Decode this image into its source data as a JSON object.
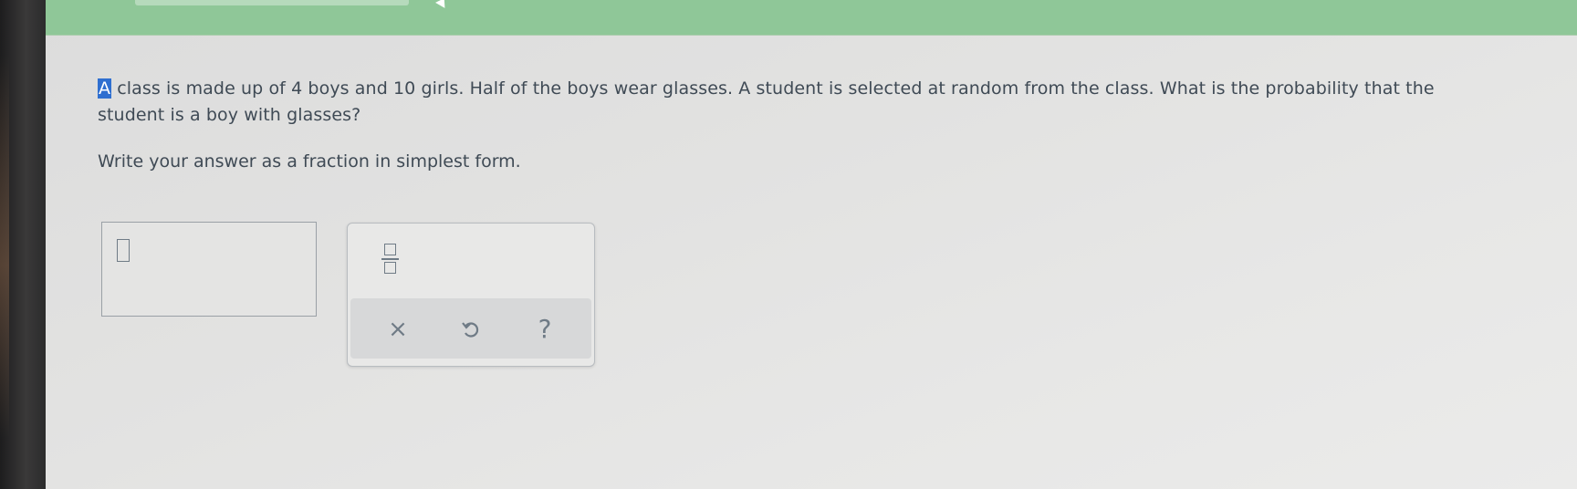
{
  "question": {
    "selected_letter": "A",
    "line1_rest": " class is made up of 4 boys and 10 girls. Half of the boys wear glasses. A student is selected at random from the class. What is the probability that the",
    "line2": "student is a boy with glasses?"
  },
  "instruction": "Write your answer as a fraction in simplest form.",
  "answer": {
    "value": ""
  },
  "keypad": {
    "clear_label": "×",
    "help_label": "?"
  },
  "colors": {
    "top_bar": "#8fc798",
    "text": "#3f4a55",
    "selection": "#2f6fd0",
    "icon": "#6f7b86"
  },
  "icons": {
    "fraction": "fraction-icon",
    "clear": "close-icon",
    "undo": "undo-icon",
    "help": "question-mark-icon",
    "cursor": "mouse-cursor-icon"
  }
}
